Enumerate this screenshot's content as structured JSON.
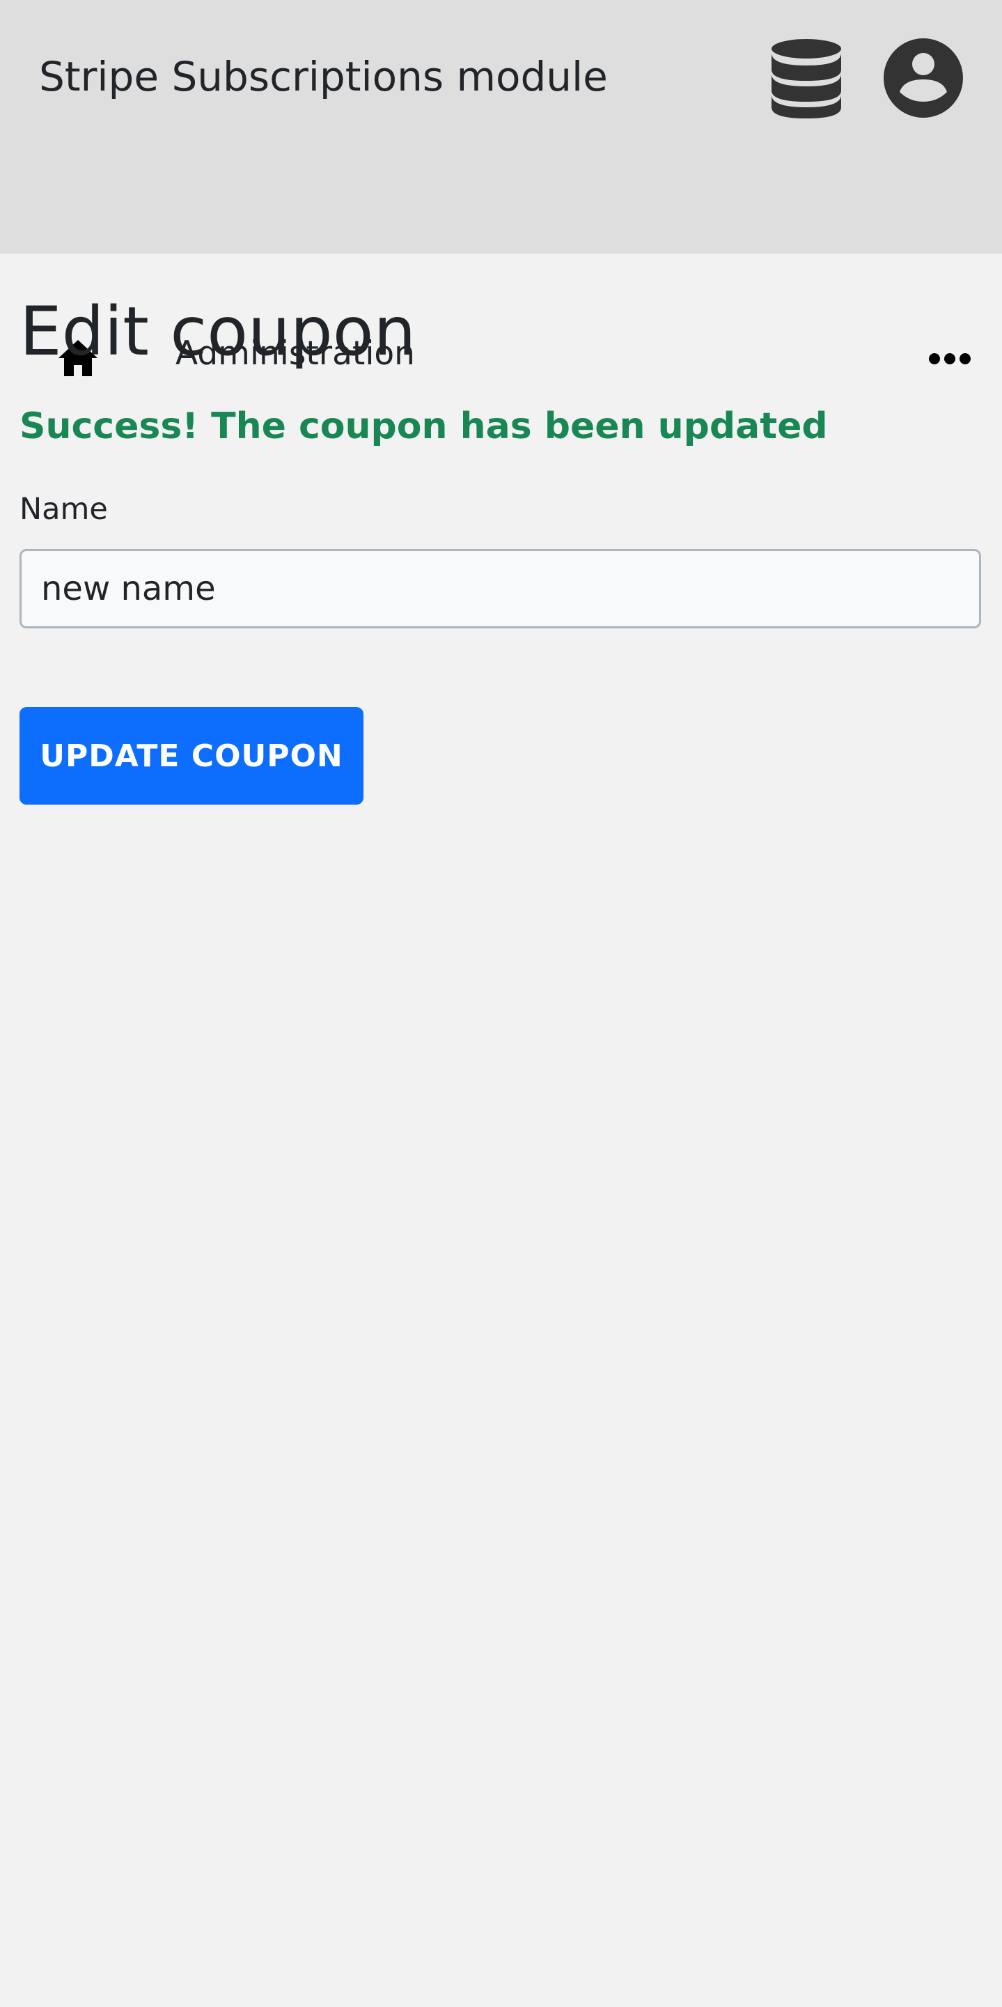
{
  "header": {
    "app_title": "Stripe Subscriptions module",
    "icons": {
      "database": "database-icon",
      "account": "account-circle-icon"
    }
  },
  "nav": {
    "home_icon": "home-icon",
    "administration_label": "Administration",
    "more_icon": "more-horizontal-icon"
  },
  "page": {
    "title": "Edit coupon",
    "success_message": "Success! The coupon has been updated"
  },
  "form": {
    "name_label": "Name",
    "name_value": "new name",
    "submit_label": "UPDATE COUPON"
  },
  "colors": {
    "header_background": "#dedede",
    "page_background": "#f2f2f2",
    "success": "#198754",
    "primary_button": "#0d6efd",
    "icon_dark": "#333333"
  }
}
